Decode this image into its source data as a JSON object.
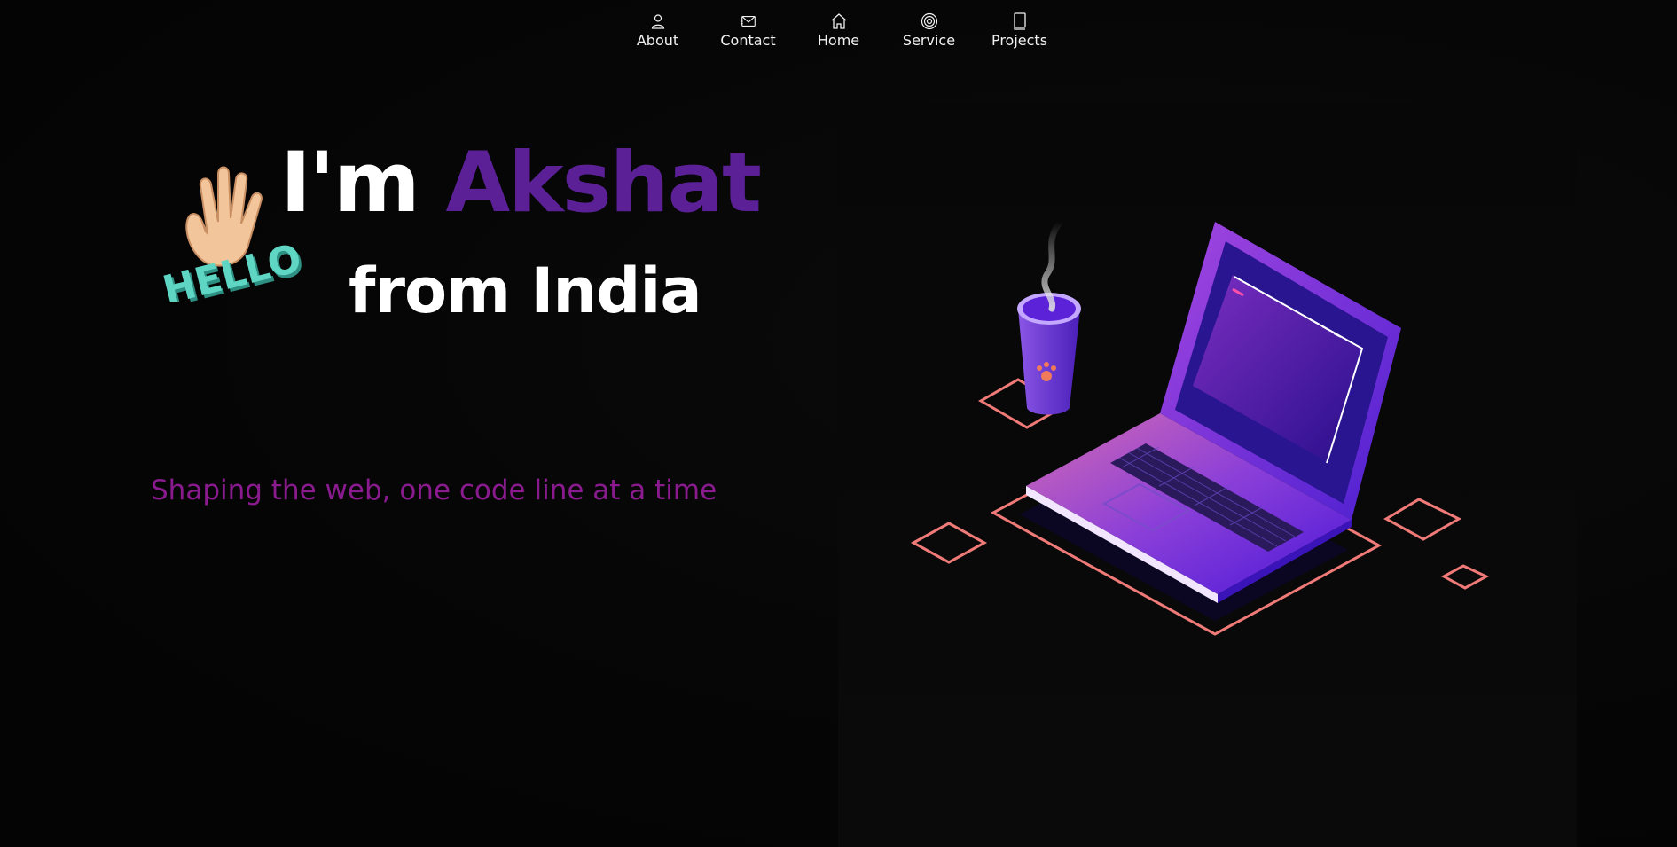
{
  "nav": {
    "items": [
      {
        "label": "About",
        "icon": "user-icon"
      },
      {
        "label": "Contact",
        "icon": "mail-icon"
      },
      {
        "label": "Home",
        "icon": "home-icon"
      },
      {
        "label": "Service",
        "icon": "target-icon"
      },
      {
        "label": "Projects",
        "icon": "book-icon"
      }
    ]
  },
  "hero": {
    "greeting_prefix": "I'm ",
    "name": "Akshat",
    "subhead": "from India",
    "tagline": "Shaping the web, one code line at a time",
    "hello_sticker": "HELLO"
  },
  "colors": {
    "background": "#050505",
    "name_accent": "#5b2096",
    "tagline": "#8a1b8f",
    "text": "#ffffff",
    "hello_teal": "#5fd6c4",
    "outline_coral": "#f07a78",
    "laptop_purple": "#6a2de0"
  }
}
